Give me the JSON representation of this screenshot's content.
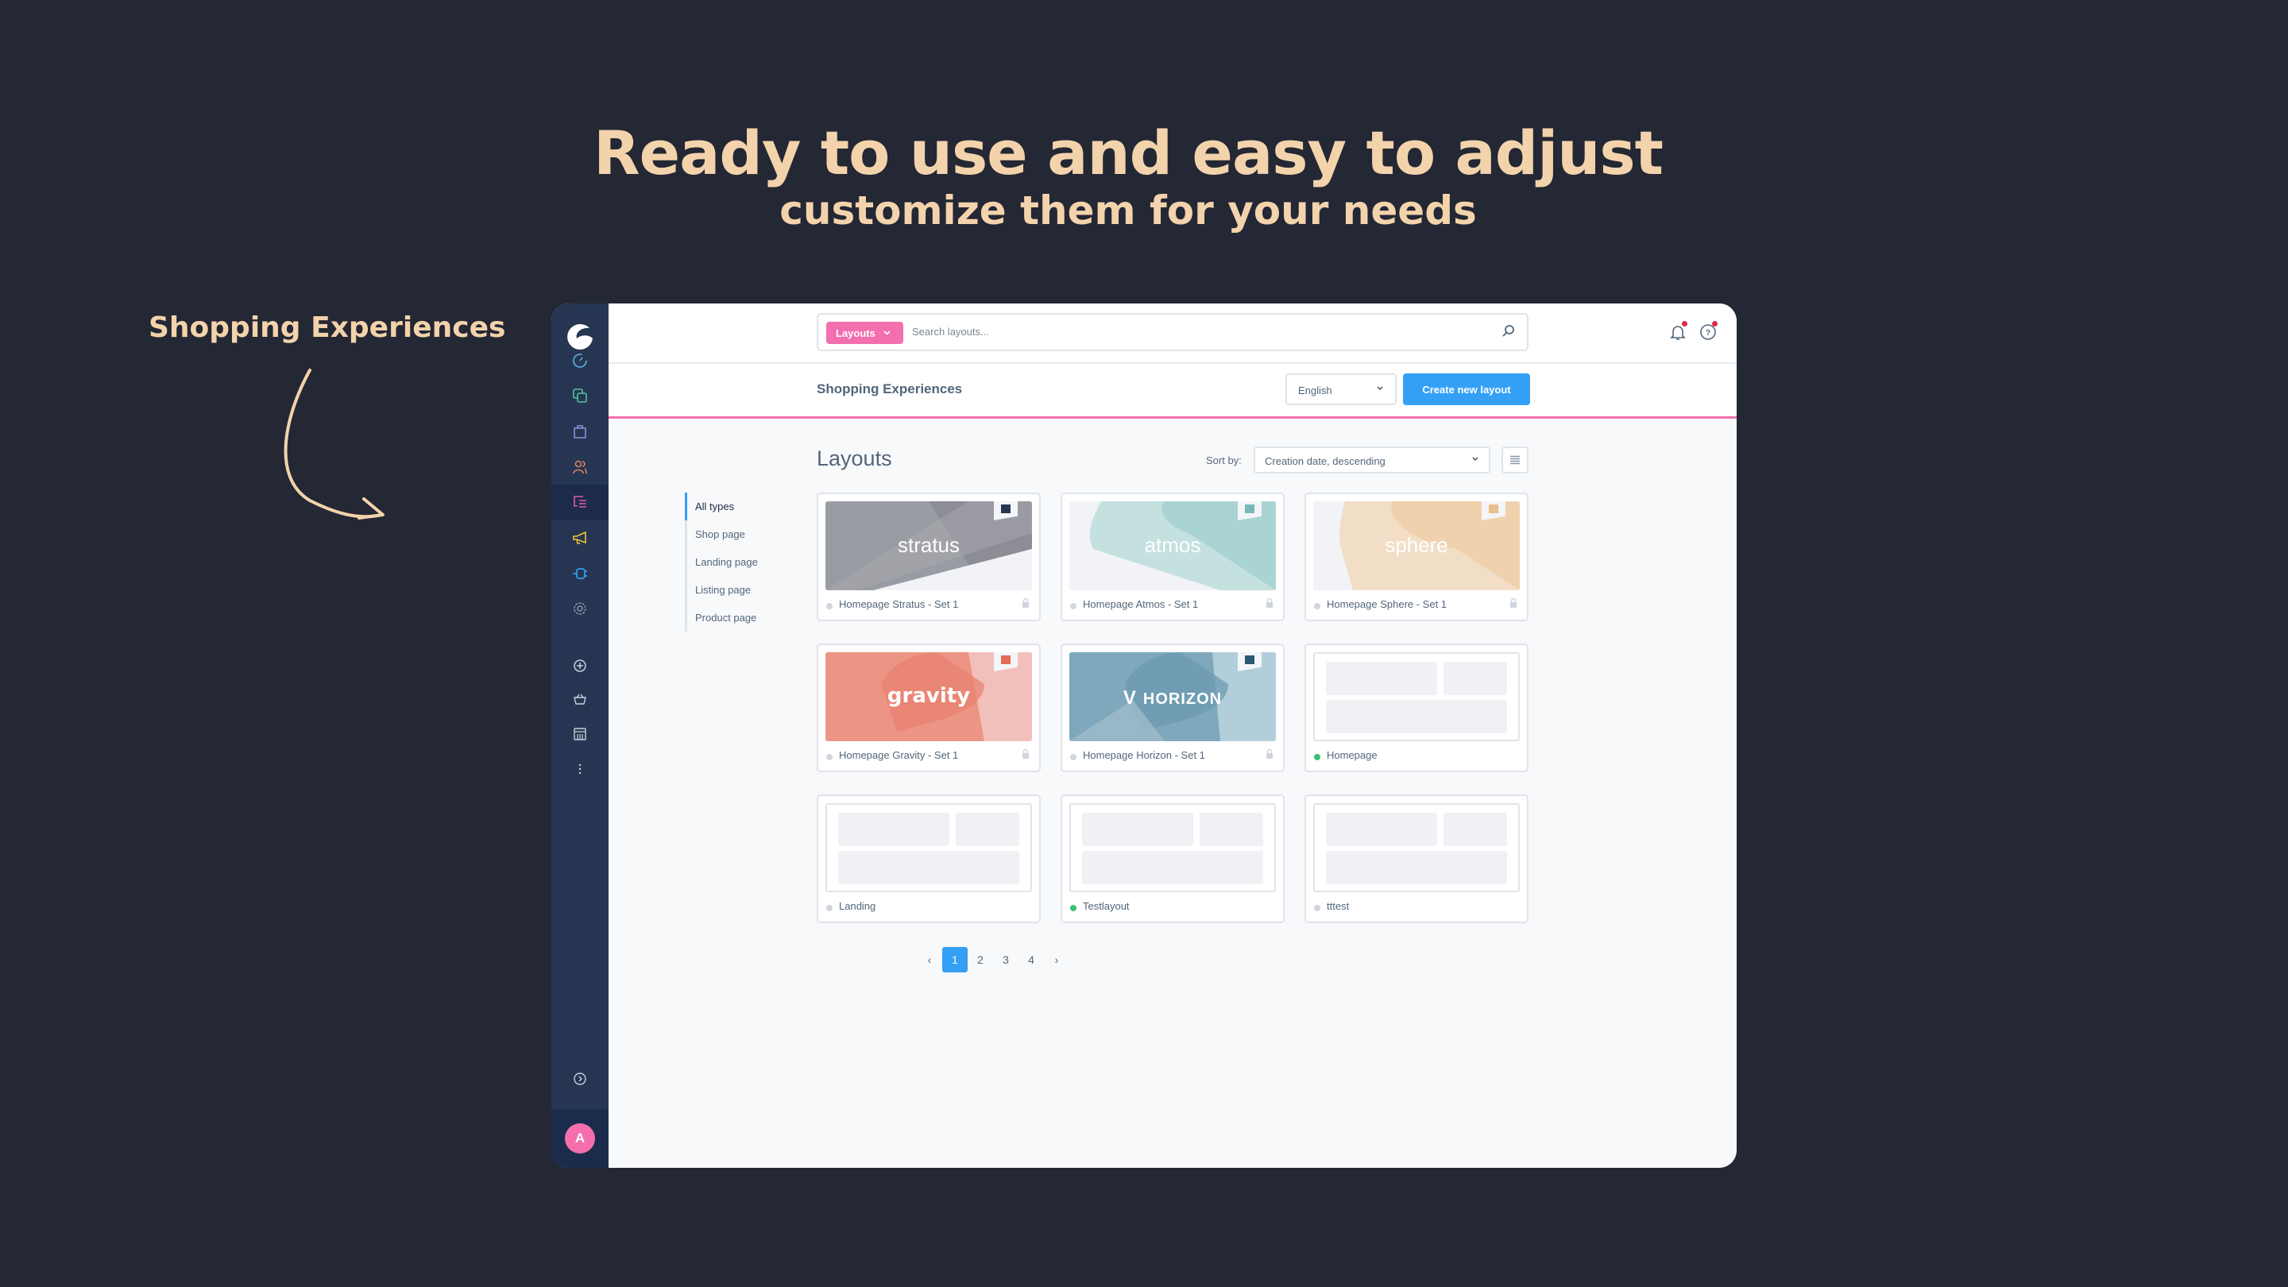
{
  "hero": {
    "title": "Ready to use and easy to adjust",
    "subtitle": "customize them for your needs",
    "callout": "Shopping Experiences"
  },
  "colors": {
    "accent_text": "#f3d3ab",
    "brand_pink": "#f36faf",
    "primary_blue": "#34a0f5",
    "active_green": "#37c172"
  },
  "sidebar": {
    "logo": "shopware-logo",
    "items": [
      {
        "icon": "dashboard-icon",
        "active": false
      },
      {
        "icon": "catalogue-icon",
        "active": false
      },
      {
        "icon": "orders-icon",
        "active": false
      },
      {
        "icon": "customers-icon",
        "active": false
      },
      {
        "icon": "content-icon",
        "active": true
      },
      {
        "icon": "marketing-icon",
        "active": false
      },
      {
        "icon": "extensions-icon",
        "active": false
      },
      {
        "icon": "settings-icon",
        "active": false
      }
    ],
    "shortcuts": [
      {
        "icon": "add-sales-channel-icon"
      },
      {
        "icon": "storefront-basket-icon"
      },
      {
        "icon": "headless-store-icon"
      },
      {
        "icon": "more-icon"
      }
    ],
    "collapse_icon": "expand-chevron-icon",
    "avatar_initial": "A"
  },
  "topbar": {
    "search_tag": "Layouts",
    "search_placeholder": "Search layouts...",
    "notifications_icon": "bell-icon",
    "help_icon": "help-icon"
  },
  "header": {
    "title": "Shopping Experiences",
    "language": "English",
    "create_button": "Create new layout"
  },
  "content": {
    "heading": "Layouts",
    "sort_label": "Sort by:",
    "sort_value": "Creation date, descending",
    "types": [
      {
        "label": "All types",
        "active": true
      },
      {
        "label": "Shop page",
        "active": false
      },
      {
        "label": "Landing page",
        "active": false
      },
      {
        "label": "Listing page",
        "active": false
      },
      {
        "label": "Product page",
        "active": false
      }
    ],
    "layouts": [
      {
        "name": "Homepage Stratus - Set 1",
        "brand": "stratus",
        "active": false,
        "locked": true
      },
      {
        "name": "Homepage Atmos - Set 1",
        "brand": "atmos",
        "active": false,
        "locked": true
      },
      {
        "name": "Homepage Sphere - Set 1",
        "brand": "sphere",
        "active": false,
        "locked": true
      },
      {
        "name": "Homepage Gravity - Set 1",
        "brand": "gravity",
        "active": false,
        "locked": true
      },
      {
        "name": "Homepage Horizon - Set 1",
        "brand": "HORIZON",
        "active": false,
        "locked": true
      },
      {
        "name": "Homepage",
        "brand": "",
        "active": true,
        "locked": false
      },
      {
        "name": "Landing",
        "brand": "",
        "active": false,
        "locked": false
      },
      {
        "name": "Testlayout",
        "brand": "",
        "active": true,
        "locked": false
      },
      {
        "name": "tttest",
        "brand": "",
        "active": false,
        "locked": false
      }
    ]
  },
  "pagination": {
    "prev": "‹",
    "next": "›",
    "pages": [
      "1",
      "2",
      "3",
      "4"
    ],
    "current": "1"
  }
}
